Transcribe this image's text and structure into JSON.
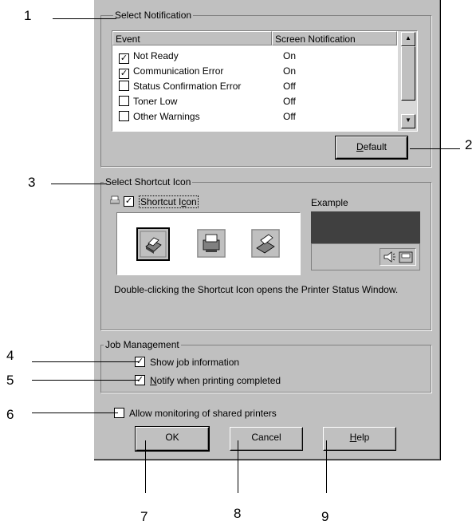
{
  "callouts": [
    "1",
    "2",
    "3",
    "4",
    "5",
    "6",
    "7",
    "8",
    "9"
  ],
  "notification": {
    "group_label": "Select Notification",
    "col_event": "Event",
    "col_screen": "Screen Notification",
    "rows": [
      {
        "event": "Not Ready",
        "value": "On",
        "checked": true
      },
      {
        "event": "Communication Error",
        "value": "On",
        "checked": true
      },
      {
        "event": "Status Confirmation Error",
        "value": "Off",
        "checked": false
      },
      {
        "event": "Toner Low",
        "value": "Off",
        "checked": false
      },
      {
        "event": "Other Warnings",
        "value": "Off",
        "checked": false
      }
    ],
    "default_label": "Default"
  },
  "shortcut": {
    "group_label": "Select Shortcut Icon",
    "checkbox_label": "Shortcut Icon",
    "checked": true,
    "example_label": "Example",
    "description": "Double-clicking the Shortcut Icon opens the Printer Status Window."
  },
  "job": {
    "group_label": "Job Management",
    "show_info": "Show job information",
    "notify": "Notify when printing completed"
  },
  "shared": {
    "label": "Allow monitoring of shared printers"
  },
  "buttons": {
    "ok": "OK",
    "cancel": "Cancel",
    "help": "Help"
  },
  "check_glyph": "✓"
}
